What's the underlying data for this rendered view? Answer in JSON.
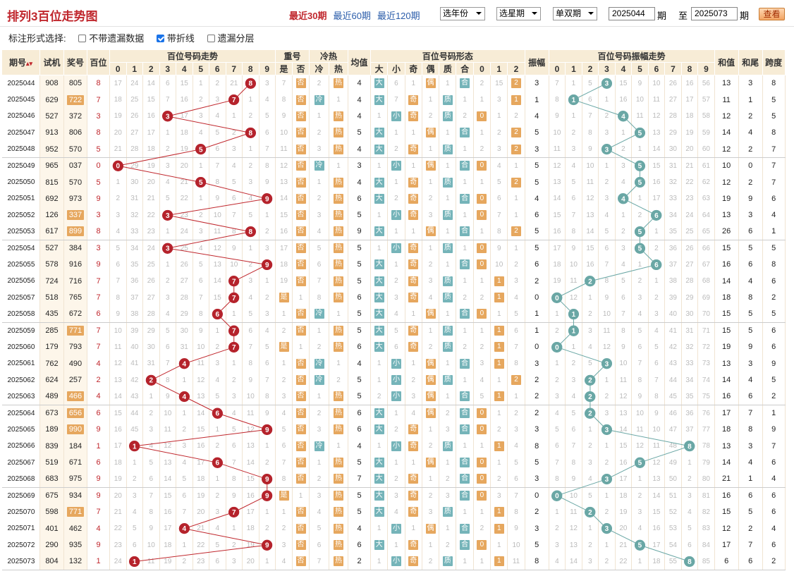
{
  "header": {
    "title": "排列3百位走势图",
    "periods": [
      "最近30期",
      "最近60期",
      "最近120期"
    ],
    "active_period": 0,
    "year_select": "选年份",
    "week_select": "选星期",
    "parity_select": "单双期",
    "from": "2025044",
    "period_word": "期",
    "to_word": "至",
    "to": "2025073",
    "period_word2": "期",
    "query": "查看"
  },
  "options": {
    "label": "标注形式选择:",
    "items": [
      {
        "label": "不带遗漏数据",
        "checked": false
      },
      {
        "label": "带折线",
        "checked": true
      },
      {
        "label": "遗漏分层",
        "checked": false
      }
    ]
  },
  "columns": {
    "period": "期号",
    "sj": "试机",
    "jh": "奖号",
    "bw": "百位",
    "trend": "百位号码走势",
    "repeat": "重号",
    "hotcold": "冷热",
    "avg": "均值",
    "form": "百位号码形态",
    "amp": "振幅",
    "amptrend": "百位号码振幅走势",
    "sum": "和值",
    "tail": "和尾",
    "span": "跨度",
    "digits": [
      "0",
      "1",
      "2",
      "3",
      "4",
      "5",
      "6",
      "7",
      "8",
      "9"
    ],
    "repeat_sub": [
      "是",
      "否"
    ],
    "hotcold_sub": [
      "冷",
      "热"
    ],
    "form_sub": [
      "大",
      "小",
      "奇",
      "偶",
      "质",
      "合",
      "0",
      "1",
      "2"
    ],
    "amp_digits": [
      "0",
      "1",
      "2",
      "3",
      "4",
      "5",
      "6",
      "7",
      "8",
      "9"
    ]
  },
  "rows": [
    [
      "2025044",
      "908",
      "805",
      "8",
      [
        17,
        24,
        14,
        6,
        15,
        1,
        2,
        21,
        "8",
        3
      ],
      [
        7,
        "否"
      ],
      [
        2,
        "热"
      ],
      "4",
      [
        "大",
        6,
        1,
        "偶",
        1,
        "合",
        2,
        15,
        "2"
      ],
      "3",
      [
        7,
        1,
        5,
        "3",
        15,
        9,
        10,
        26,
        16,
        56
      ],
      "13",
      "3",
      "8"
    ],
    [
      "2025045",
      "629",
      "722",
      "7",
      [
        18,
        25,
        15,
        7,
        16,
        2,
        3,
        "7",
        1,
        4
      ],
      [
        8,
        "否"
      ],
      [
        "冷",
        1
      ],
      "4",
      [
        "大",
        7,
        "奇",
        1,
        "质",
        1,
        1,
        3,
        "1"
      ],
      "1",
      [
        8,
        "1",
        6,
        1,
        16,
        10,
        11,
        27,
        17,
        57
      ],
      "11",
      "1",
      "5"
    ],
    [
      "2025046",
      "527",
      "372",
      "3",
      [
        19,
        26,
        16,
        "3",
        17,
        3,
        4,
        1,
        2,
        5
      ],
      [
        9,
        "否"
      ],
      [
        1,
        "热"
      ],
      "4",
      [
        1,
        "小",
        "奇",
        2,
        "质",
        2,
        "0",
        1,
        2
      ],
      "4",
      [
        9,
        1,
        7,
        2,
        "4",
        11,
        12,
        28,
        18,
        58
      ],
      "12",
      "2",
      "5"
    ],
    [
      "2025047",
      "913",
      "806",
      "8",
      [
        20,
        27,
        17,
        1,
        18,
        4,
        5,
        2,
        "8",
        6
      ],
      [
        10,
        "否"
      ],
      [
        2,
        "热"
      ],
      "5",
      [
        "大",
        1,
        1,
        "偶",
        1,
        "合",
        1,
        2,
        "2"
      ],
      "5",
      [
        10,
        2,
        8,
        3,
        1,
        "5",
        13,
        29,
        19,
        59
      ],
      "14",
      "4",
      "8"
    ],
    [
      "2025048",
      "952",
      "570",
      "5",
      [
        21,
        28,
        18,
        2,
        19,
        "5",
        6,
        3,
        1,
        7
      ],
      [
        11,
        "否"
      ],
      [
        3,
        "热"
      ],
      "4",
      [
        "大",
        2,
        "奇",
        1,
        "质",
        1,
        2,
        3,
        "2"
      ],
      "3",
      [
        11,
        3,
        9,
        "3",
        2,
        1,
        14,
        30,
        20,
        60
      ],
      "12",
      "2",
      "7"
    ],
    [
      "2025049",
      "965",
      "037",
      "0",
      [
        "0",
        29,
        19,
        3,
        20,
        1,
        7,
        4,
        2,
        8
      ],
      [
        12,
        "否"
      ],
      [
        "冷",
        1
      ],
      "3",
      [
        1,
        "小",
        1,
        "偶",
        1,
        "合",
        "0",
        4,
        1
      ],
      "5",
      [
        12,
        4,
        10,
        1,
        3,
        "5",
        15,
        31,
        21,
        61
      ],
      "10",
      "0",
      "7"
    ],
    [
      "2025050",
      "815",
      "570",
      "5",
      [
        1,
        30,
        20,
        4,
        21,
        "5",
        8,
        5,
        3,
        9
      ],
      [
        13,
        "否"
      ],
      [
        1,
        "热"
      ],
      "4",
      [
        "大",
        1,
        "奇",
        1,
        "质",
        1,
        1,
        5,
        "2"
      ],
      "5",
      [
        13,
        5,
        11,
        2,
        4,
        "5",
        16,
        32,
        22,
        62
      ],
      "12",
      "2",
      "7"
    ],
    [
      "2025051",
      "692",
      "973",
      "9",
      [
        2,
        31,
        21,
        5,
        22,
        1,
        9,
        6,
        4,
        "9"
      ],
      [
        14,
        "否"
      ],
      [
        2,
        "热"
      ],
      "6",
      [
        "大",
        2,
        "奇",
        2,
        1,
        "合",
        "0",
        6,
        1
      ],
      "4",
      [
        14,
        6,
        12,
        3,
        "4",
        1,
        17,
        33,
        23,
        63
      ],
      "19",
      "9",
      "6"
    ],
    [
      "2025052",
      "126",
      "337",
      "3",
      [
        3,
        32,
        22,
        "3",
        23,
        2,
        10,
        7,
        5,
        1
      ],
      [
        15,
        "否"
      ],
      [
        3,
        "热"
      ],
      "5",
      [
        1,
        "小",
        "奇",
        3,
        "质",
        1,
        "0",
        7,
        1
      ],
      "6",
      [
        15,
        7,
        13,
        4,
        1,
        2,
        "6",
        34,
        24,
        64
      ],
      "13",
      "3",
      "4"
    ],
    [
      "2025053",
      "617",
      "899",
      "8",
      [
        4,
        33,
        23,
        1,
        24,
        3,
        11,
        8,
        "8",
        2
      ],
      [
        16,
        "否"
      ],
      [
        4,
        "热"
      ],
      "9",
      [
        "大",
        1,
        1,
        "偶",
        1,
        "合",
        1,
        8,
        "2"
      ],
      "5",
      [
        16,
        8,
        14,
        5,
        2,
        "5",
        1,
        35,
        25,
        65
      ],
      "26",
      "6",
      "1"
    ],
    [
      "2025054",
      "527",
      "384",
      "3",
      [
        5,
        34,
        24,
        "3",
        25,
        4,
        12,
        9,
        1,
        3
      ],
      [
        17,
        "否"
      ],
      [
        5,
        "热"
      ],
      "5",
      [
        1,
        "小",
        "奇",
        1,
        "质",
        1,
        "0",
        9,
        1
      ],
      "5",
      [
        17,
        9,
        15,
        6,
        3,
        "5",
        2,
        36,
        26,
        66
      ],
      "15",
      "5",
      "5"
    ],
    [
      "2025055",
      "578",
      "916",
      "9",
      [
        6,
        35,
        25,
        1,
        26,
        5,
        13,
        10,
        2,
        "9"
      ],
      [
        18,
        "否"
      ],
      [
        6,
        "热"
      ],
      "5",
      [
        "大",
        1,
        "奇",
        2,
        1,
        "合",
        "0",
        10,
        2
      ],
      "6",
      [
        18,
        10,
        16,
        7,
        4,
        1,
        "6",
        37,
        27,
        67
      ],
      "16",
      "6",
      "8"
    ],
    [
      "2025056",
      "724",
      "716",
      "7",
      [
        7,
        36,
        26,
        2,
        27,
        6,
        14,
        "7",
        3,
        1
      ],
      [
        19,
        "否"
      ],
      [
        7,
        "热"
      ],
      "5",
      [
        "大",
        2,
        "奇",
        3,
        "质",
        1,
        1,
        "1",
        3
      ],
      "2",
      [
        19,
        11,
        "2",
        8,
        5,
        2,
        1,
        38,
        28,
        68
      ],
      "14",
      "4",
      "6"
    ],
    [
      "2025057",
      "518",
      "765",
      "7",
      [
        8,
        37,
        27,
        3,
        28,
        7,
        15,
        "7",
        4,
        2
      ],
      [
        "是",
        1
      ],
      [
        8,
        "热"
      ],
      "6",
      [
        "大",
        3,
        "奇",
        4,
        "质",
        2,
        2,
        "1",
        4
      ],
      "0",
      [
        "0",
        12,
        1,
        9,
        6,
        3,
        2,
        39,
        29,
        69
      ],
      "18",
      "8",
      "2"
    ],
    [
      "2025058",
      "435",
      "672",
      "6",
      [
        9,
        38,
        28,
        4,
        29,
        8,
        "6",
        1,
        5,
        3
      ],
      [
        1,
        "否"
      ],
      [
        "冷",
        1
      ],
      "5",
      [
        "大",
        4,
        1,
        "偶",
        1,
        "合",
        "0",
        1,
        5
      ],
      "1",
      [
        1,
        "1",
        2,
        10,
        7,
        4,
        3,
        40,
        30,
        70
      ],
      "15",
      "5",
      "5"
    ],
    [
      "2025059",
      "285",
      "771",
      "7",
      [
        10,
        39,
        29,
        5,
        30,
        9,
        1,
        "7",
        6,
        4
      ],
      [
        2,
        "否"
      ],
      [
        1,
        "热"
      ],
      "5",
      [
        "大",
        5,
        "奇",
        1,
        "质",
        1,
        1,
        "1",
        6
      ],
      "1",
      [
        2,
        "1",
        3,
        11,
        8,
        5,
        4,
        41,
        31,
        71
      ],
      "15",
      "5",
      "6"
    ],
    [
      "2025060",
      "179",
      "793",
      "7",
      [
        11,
        40,
        30,
        6,
        31,
        10,
        2,
        "7",
        7,
        5
      ],
      [
        "是",
        1
      ],
      [
        2,
        "热"
      ],
      "6",
      [
        "大",
        6,
        "奇",
        2,
        "质",
        2,
        2,
        "1",
        7
      ],
      "0",
      [
        "0",
        1,
        4,
        12,
        9,
        6,
        5,
        42,
        32,
        72
      ],
      "19",
      "9",
      "6"
    ],
    [
      "2025061",
      "762",
      "490",
      "4",
      [
        12,
        41,
        31,
        7,
        "4",
        11,
        3,
        1,
        8,
        6
      ],
      [
        1,
        "否"
      ],
      [
        "冷",
        1
      ],
      "4",
      [
        1,
        "小",
        1,
        "偶",
        1,
        "合",
        3,
        "1",
        8
      ],
      "3",
      [
        1,
        2,
        5,
        "3",
        10,
        7,
        6,
        43,
        33,
        73
      ],
      "13",
      "3",
      "9"
    ],
    [
      "2025062",
      "624",
      "257",
      "2",
      [
        13,
        42,
        "2",
        8,
        1,
        12,
        4,
        2,
        9,
        7
      ],
      [
        2,
        "否"
      ],
      [
        "冷",
        2
      ],
      "5",
      [
        1,
        "小",
        2,
        "偶",
        "质",
        1,
        4,
        1,
        "2"
      ],
      "2",
      [
        2,
        3,
        "2",
        1,
        11,
        8,
        7,
        44,
        34,
        74
      ],
      "14",
      "4",
      "5"
    ],
    [
      "2025063",
      "489",
      "466",
      "4",
      [
        14,
        43,
        1,
        9,
        "4",
        13,
        5,
        3,
        10,
        8
      ],
      [
        3,
        "否"
      ],
      [
        1,
        "热"
      ],
      "5",
      [
        2,
        "小",
        3,
        "偶",
        1,
        "合",
        5,
        "1",
        1
      ],
      "2",
      [
        3,
        4,
        "2",
        2,
        12,
        9,
        8,
        45,
        35,
        75
      ],
      "16",
      "6",
      "2"
    ],
    [
      "2025064",
      "673",
      "656",
      "6",
      [
        15,
        44,
        2,
        10,
        1,
        14,
        "6",
        4,
        11,
        9
      ],
      [
        4,
        "否"
      ],
      [
        2,
        "热"
      ],
      "6",
      [
        "大",
        1,
        4,
        "偶",
        2,
        "合",
        "0",
        1,
        2
      ],
      "2",
      [
        4,
        5,
        "2",
        3,
        13,
        10,
        9,
        46,
        36,
        76
      ],
      "17",
      "7",
      "1"
    ],
    [
      "2025065",
      "189",
      "990",
      "9",
      [
        16,
        45,
        3,
        11,
        2,
        15,
        1,
        5,
        12,
        "9"
      ],
      [
        5,
        "否"
      ],
      [
        3,
        "热"
      ],
      "6",
      [
        "大",
        2,
        "奇",
        1,
        3,
        "合",
        "0",
        2,
        3
      ],
      "3",
      [
        5,
        6,
        1,
        "3",
        14,
        11,
        10,
        47,
        37,
        77
      ],
      "18",
      "8",
      "9"
    ],
    [
      "2025066",
      "839",
      "184",
      "1",
      [
        17,
        "1",
        4,
        12,
        3,
        16,
        2,
        6,
        13,
        1
      ],
      [
        6,
        "否"
      ],
      [
        "冷",
        1
      ],
      "4",
      [
        1,
        "小",
        "奇",
        2,
        "质",
        1,
        1,
        "1",
        4
      ],
      "8",
      [
        6,
        7,
        2,
        1,
        15,
        12,
        11,
        48,
        "8",
        78
      ],
      "13",
      "3",
      "7"
    ],
    [
      "2025067",
      "519",
      "671",
      "6",
      [
        18,
        1,
        5,
        13,
        4,
        17,
        "6",
        7,
        14,
        2
      ],
      [
        7,
        "否"
      ],
      [
        1,
        "热"
      ],
      "5",
      [
        "大",
        1,
        1,
        "偶",
        1,
        "合",
        "0",
        1,
        5
      ],
      "5",
      [
        7,
        8,
        3,
        2,
        16,
        "5",
        12,
        49,
        1,
        79
      ],
      "14",
      "4",
      "6"
    ],
    [
      "2025068",
      "683",
      "975",
      "9",
      [
        19,
        2,
        6,
        14,
        5,
        18,
        1,
        8,
        15,
        "9"
      ],
      [
        8,
        "否"
      ],
      [
        2,
        "热"
      ],
      "7",
      [
        "大",
        2,
        "奇",
        1,
        2,
        "合",
        "0",
        2,
        6
      ],
      "3",
      [
        8,
        9,
        4,
        "3",
        17,
        1,
        13,
        50,
        2,
        80
      ],
      "21",
      "1",
      "4"
    ],
    [
      "2025069",
      "675",
      "934",
      "9",
      [
        20,
        3,
        7,
        15,
        6,
        19,
        2,
        9,
        16,
        "9"
      ],
      [
        "是",
        1
      ],
      [
        3,
        "热"
      ],
      "5",
      [
        "大",
        3,
        "奇",
        2,
        3,
        "合",
        "0",
        3,
        7
      ],
      "0",
      [
        "0",
        10,
        5,
        1,
        18,
        2,
        14,
        51,
        3,
        81
      ],
      "16",
      "6",
      "6"
    ],
    [
      "2025070",
      "598",
      "771",
      "7",
      [
        21,
        4,
        8,
        16,
        7,
        20,
        3,
        "7",
        17,
        1
      ],
      [
        1,
        "否"
      ],
      [
        4,
        "热"
      ],
      "5",
      [
        "大",
        4,
        "奇",
        3,
        "质",
        1,
        1,
        "1",
        8
      ],
      "2",
      [
        1,
        11,
        "2",
        2,
        19,
        3,
        15,
        52,
        4,
        82
      ],
      "15",
      "5",
      "6"
    ],
    [
      "2025071",
      "401",
      "462",
      "4",
      [
        22,
        5,
        9,
        17,
        "4",
        21,
        4,
        1,
        18,
        2
      ],
      [
        2,
        "否"
      ],
      [
        5,
        "热"
      ],
      "4",
      [
        1,
        "小",
        1,
        "偶",
        1,
        "合",
        2,
        "1",
        9
      ],
      "3",
      [
        2,
        12,
        1,
        "3",
        20,
        4,
        16,
        53,
        5,
        83
      ],
      "12",
      "2",
      "4"
    ],
    [
      "2025072",
      "290",
      "935",
      "9",
      [
        23,
        6,
        10,
        18,
        1,
        22,
        5,
        2,
        19,
        "9"
      ],
      [
        3,
        "否"
      ],
      [
        6,
        "热"
      ],
      "6",
      [
        "大",
        1,
        "奇",
        1,
        2,
        "合",
        "0",
        1,
        10
      ],
      "5",
      [
        3,
        13,
        2,
        1,
        21,
        "5",
        17,
        54,
        6,
        84
      ],
      "17",
      "7",
      "6"
    ],
    [
      "2025073",
      "804",
      "132",
      "1",
      [
        24,
        "1",
        11,
        19,
        2,
        23,
        6,
        3,
        20,
        1
      ],
      [
        4,
        "否"
      ],
      [
        7,
        "热"
      ],
      "2",
      [
        1,
        "小",
        "奇",
        2,
        "质",
        1,
        1,
        "1",
        11
      ],
      "8",
      [
        4,
        14,
        3,
        2,
        22,
        1,
        18,
        55,
        "8",
        85
      ],
      "6",
      "6",
      "2"
    ]
  ]
}
